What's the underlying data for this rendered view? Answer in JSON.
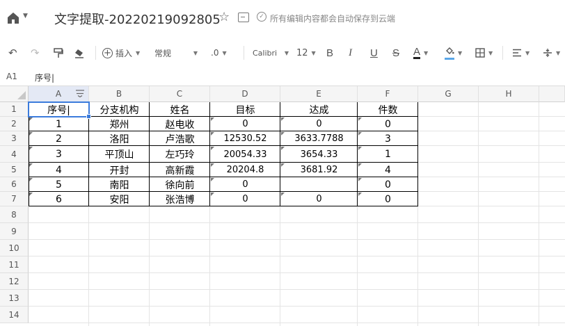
{
  "header": {
    "title": "文字提取-20220219092805",
    "save_status": "所有编辑内容都会自动保存到云端"
  },
  "toolbar": {
    "insert_label": "插入",
    "format_label": "常规",
    "decimal_label": ".0",
    "font_name": "Calibri",
    "font_size": "12"
  },
  "formula_bar": {
    "cell_ref": "A1",
    "content": "序号|"
  },
  "sheet": {
    "column_headers": [
      "A",
      "B",
      "C",
      "D",
      "E",
      "F",
      "G",
      "H"
    ],
    "row_headers": [
      "1",
      "2",
      "3",
      "4",
      "5",
      "6",
      "7",
      "8",
      "9",
      "10",
      "11",
      "12",
      "13",
      "14"
    ],
    "header_row": [
      "序号|",
      "分支机构",
      "姓名",
      "目标",
      "达成",
      "件数"
    ],
    "rows": [
      [
        "1",
        "郑州",
        "赵电收",
        "0",
        "0",
        "0"
      ],
      [
        "2",
        "洛阳",
        "卢浩歌",
        "12530.52",
        "3633.7788",
        "3"
      ],
      [
        "3",
        "平顶山",
        "左巧玲",
        "20054.33",
        "3654.33",
        "1"
      ],
      [
        "4",
        "开封",
        "高新霞",
        "20204.8",
        "3681.92",
        "4"
      ],
      [
        "5",
        "南阳",
        "徐向前",
        "0",
        "",
        "0"
      ],
      [
        "6",
        "安阳",
        "张浩博",
        "0",
        "0",
        "0"
      ]
    ]
  }
}
